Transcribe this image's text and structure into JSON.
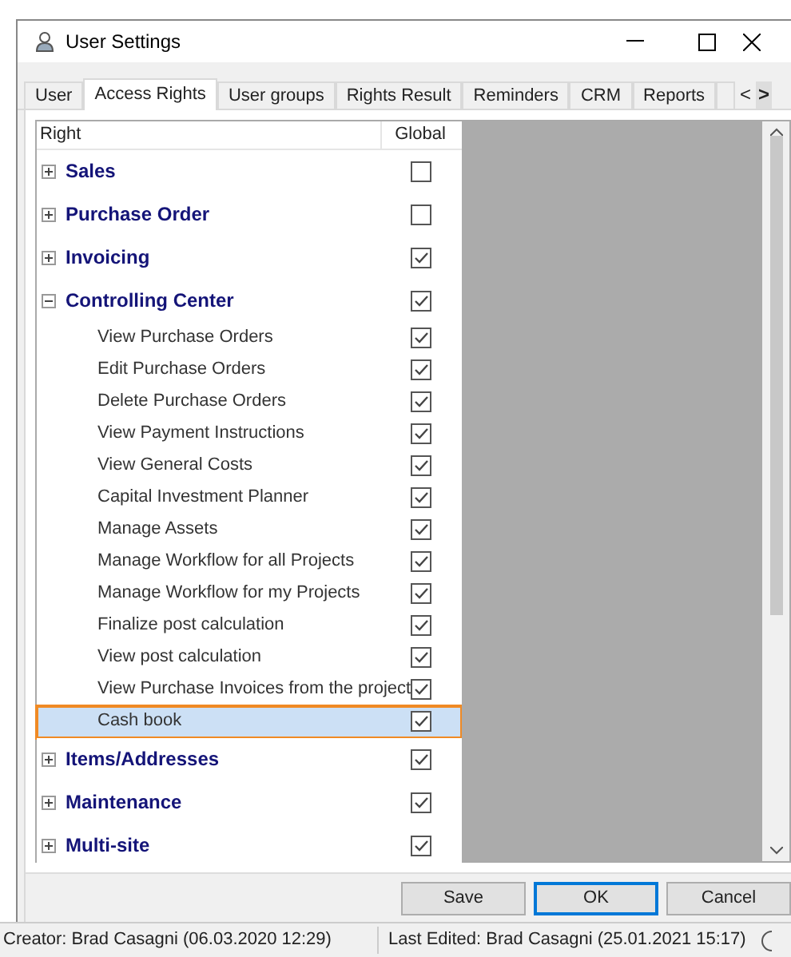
{
  "window": {
    "title": "User Settings"
  },
  "tabs": [
    {
      "label": "User",
      "selected": false
    },
    {
      "label": "Access Rights",
      "selected": true
    },
    {
      "label": "User groups",
      "selected": false
    },
    {
      "label": "Rights Result",
      "selected": false
    },
    {
      "label": "Reminders",
      "selected": false
    },
    {
      "label": "CRM",
      "selected": false
    },
    {
      "label": "Reports",
      "selected": false
    }
  ],
  "tab_scroll": {
    "left": "<",
    "right": ">"
  },
  "table": {
    "columns": [
      "Right",
      "Global"
    ],
    "rows": [
      {
        "label": "Sales",
        "expanded": false,
        "checked": false,
        "selected": false,
        "children": []
      },
      {
        "label": "Purchase Order",
        "expanded": false,
        "checked": false,
        "selected": false,
        "children": []
      },
      {
        "label": "Invoicing",
        "expanded": false,
        "checked": true,
        "selected": false,
        "children": []
      },
      {
        "label": "Controlling Center",
        "expanded": true,
        "checked": true,
        "selected": false,
        "children": [
          {
            "label": "View Purchase Orders",
            "checked": true,
            "selected": false
          },
          {
            "label": "Edit Purchase Orders",
            "checked": true,
            "selected": false
          },
          {
            "label": "Delete Purchase Orders",
            "checked": true,
            "selected": false
          },
          {
            "label": "View Payment Instructions",
            "checked": true,
            "selected": false
          },
          {
            "label": "View General Costs",
            "checked": true,
            "selected": false
          },
          {
            "label": "Capital Investment Planner",
            "checked": true,
            "selected": false
          },
          {
            "label": "Manage Assets",
            "checked": true,
            "selected": false
          },
          {
            "label": "Manage Workflow for all Projects",
            "checked": true,
            "selected": false
          },
          {
            "label": "Manage Workflow for my Projects",
            "checked": true,
            "selected": false
          },
          {
            "label": "Finalize post calculation",
            "checked": true,
            "selected": false
          },
          {
            "label": "View post calculation",
            "checked": true,
            "selected": false
          },
          {
            "label": "View Purchase Invoices from the project",
            "checked": true,
            "selected": false
          },
          {
            "label": "Cash book",
            "checked": true,
            "selected": true
          }
        ]
      },
      {
        "label": "Items/Addresses",
        "expanded": false,
        "checked": true,
        "selected": false,
        "children": []
      },
      {
        "label": "Maintenance",
        "expanded": false,
        "checked": true,
        "selected": false,
        "children": []
      },
      {
        "label": "Multi-site",
        "expanded": false,
        "checked": true,
        "selected": false,
        "children": []
      }
    ]
  },
  "buttons": [
    {
      "label": "Save",
      "default": false
    },
    {
      "label": "OK",
      "default": true
    },
    {
      "label": "Cancel",
      "default": false
    }
  ],
  "status_bar": {
    "creator": "Creator: Brad Casagni (06.03.2020 12:29)",
    "last_edited": "Last Edited:  Brad Casagni (25.01.2021 15:17)"
  }
}
